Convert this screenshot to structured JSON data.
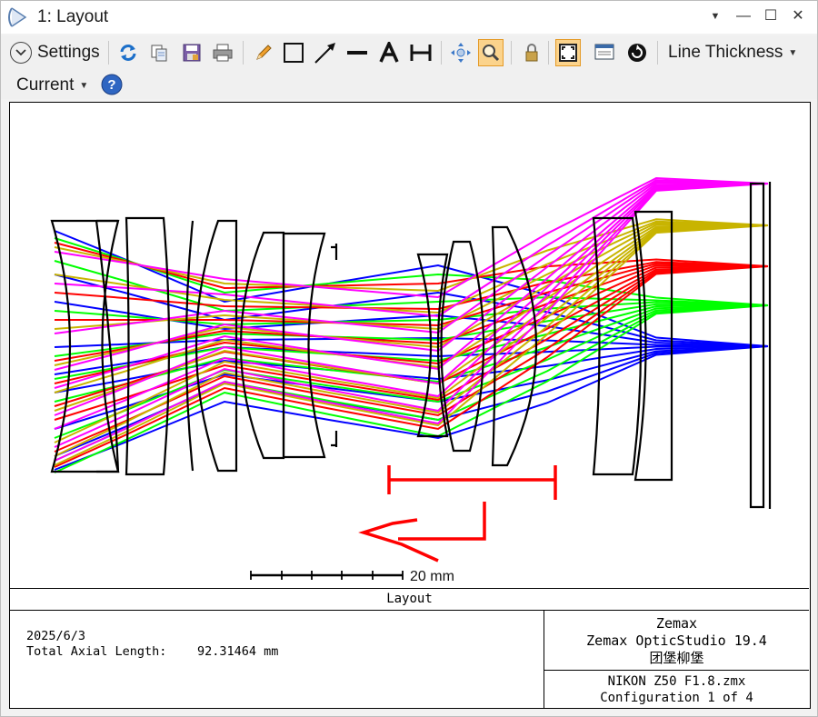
{
  "window": {
    "title": "1: Layout",
    "controls": {
      "minimize": "—",
      "maximize": "☐",
      "close": "✕",
      "pin": "▼"
    }
  },
  "toolbar": {
    "settings_label": "Settings",
    "line_thickness_label": "Line Thickness",
    "current_label": "Current",
    "icons": [
      "refresh-icon",
      "copy-icon",
      "save-icon",
      "print-icon",
      "pencil-icon",
      "rectangle-icon",
      "arrow-icon",
      "line-icon",
      "text-icon",
      "dimension-icon",
      "pan-icon",
      "zoom-icon",
      "lock-icon",
      "fit-icon",
      "window-icon",
      "rotate-icon",
      "help-icon"
    ]
  },
  "plot": {
    "scale_bar_label": "20 mm",
    "ray_colors": [
      "#0000ff",
      "#00ff00",
      "#ff0000",
      "#c8b400",
      "#ff00ff"
    ],
    "annotation_color": "#ff0000",
    "title_strip": "Layout"
  },
  "info": {
    "date": "2025/6/3",
    "total_axial_length_label": "Total Axial Length:",
    "total_axial_length_value": "92.31464 mm",
    "company": "Zemax",
    "product": "Zemax OpticStudio 19.4",
    "user": "团堡柳堡",
    "file": "NIKON Z50 F1.8.zmx",
    "configuration": "Configuration 1 of 4"
  }
}
